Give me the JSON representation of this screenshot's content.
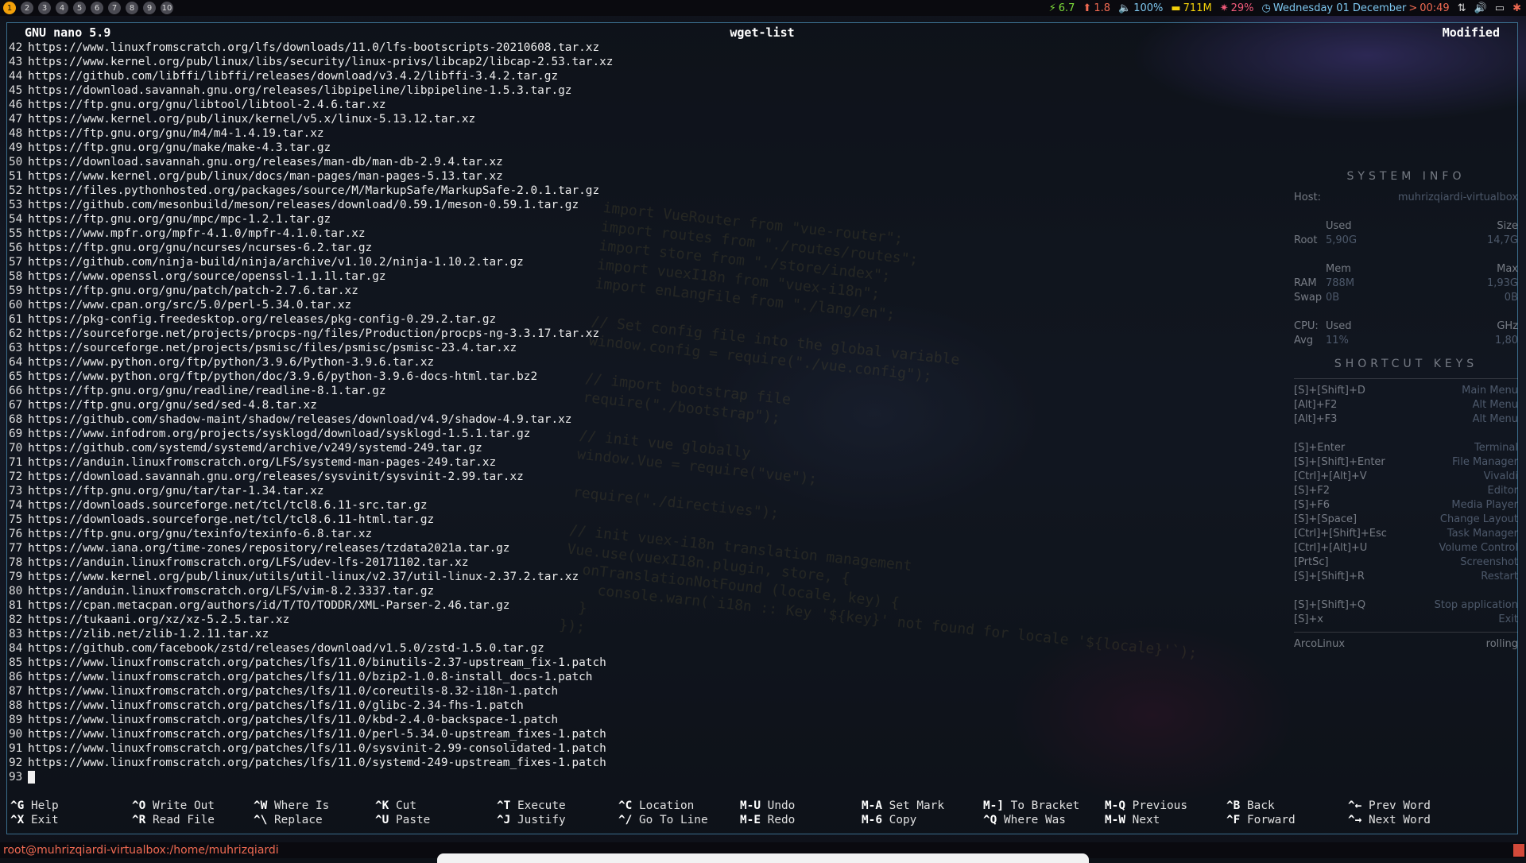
{
  "topbar": {
    "workspaces": [
      "1",
      "2",
      "3",
      "4",
      "5",
      "6",
      "7",
      "8",
      "9",
      "10"
    ],
    "active_workspace": "1",
    "status": {
      "cpu": "6.7",
      "upload": "1.8",
      "volume": "100%",
      "memory": "711M",
      "cpu_percent": "29%",
      "date": "Wednesday 01 December",
      "separator": ">",
      "time": "00:49"
    }
  },
  "nano": {
    "app_title": "GNU nano 5.9",
    "file_name": "wget-list",
    "state": "Modified",
    "lines": [
      {
        "n": "42",
        "text": "https://www.linuxfromscratch.org/lfs/downloads/11.0/lfs-bootscripts-20210608.tar.xz"
      },
      {
        "n": "43",
        "text": "https://www.kernel.org/pub/linux/libs/security/linux-privs/libcap2/libcap-2.53.tar.xz"
      },
      {
        "n": "44",
        "text": "https://github.com/libffi/libffi/releases/download/v3.4.2/libffi-3.4.2.tar.gz"
      },
      {
        "n": "45",
        "text": "https://download.savannah.gnu.org/releases/libpipeline/libpipeline-1.5.3.tar.gz"
      },
      {
        "n": "46",
        "text": "https://ftp.gnu.org/gnu/libtool/libtool-2.4.6.tar.xz"
      },
      {
        "n": "47",
        "text": "https://www.kernel.org/pub/linux/kernel/v5.x/linux-5.13.12.tar.xz"
      },
      {
        "n": "48",
        "text": "https://ftp.gnu.org/gnu/m4/m4-1.4.19.tar.xz"
      },
      {
        "n": "49",
        "text": "https://ftp.gnu.org/gnu/make/make-4.3.tar.gz"
      },
      {
        "n": "50",
        "text": "https://download.savannah.gnu.org/releases/man-db/man-db-2.9.4.tar.xz"
      },
      {
        "n": "51",
        "text": "https://www.kernel.org/pub/linux/docs/man-pages/man-pages-5.13.tar.xz"
      },
      {
        "n": "52",
        "text": "https://files.pythonhosted.org/packages/source/M/MarkupSafe/MarkupSafe-2.0.1.tar.gz"
      },
      {
        "n": "53",
        "text": "https://github.com/mesonbuild/meson/releases/download/0.59.1/meson-0.59.1.tar.gz"
      },
      {
        "n": "54",
        "text": "https://ftp.gnu.org/gnu/mpc/mpc-1.2.1.tar.gz"
      },
      {
        "n": "55",
        "text": "https://www.mpfr.org/mpfr-4.1.0/mpfr-4.1.0.tar.xz"
      },
      {
        "n": "56",
        "text": "https://ftp.gnu.org/gnu/ncurses/ncurses-6.2.tar.gz"
      },
      {
        "n": "57",
        "text": "https://github.com/ninja-build/ninja/archive/v1.10.2/ninja-1.10.2.tar.gz"
      },
      {
        "n": "58",
        "text": "https://www.openssl.org/source/openssl-1.1.1l.tar.gz"
      },
      {
        "n": "59",
        "text": "https://ftp.gnu.org/gnu/patch/patch-2.7.6.tar.xz"
      },
      {
        "n": "60",
        "text": "https://www.cpan.org/src/5.0/perl-5.34.0.tar.xz"
      },
      {
        "n": "61",
        "text": "https://pkg-config.freedesktop.org/releases/pkg-config-0.29.2.tar.gz"
      },
      {
        "n": "62",
        "text": "https://sourceforge.net/projects/procps-ng/files/Production/procps-ng-3.3.17.tar.xz"
      },
      {
        "n": "63",
        "text": "https://sourceforge.net/projects/psmisc/files/psmisc/psmisc-23.4.tar.xz"
      },
      {
        "n": "64",
        "text": "https://www.python.org/ftp/python/3.9.6/Python-3.9.6.tar.xz"
      },
      {
        "n": "65",
        "text": "https://www.python.org/ftp/python/doc/3.9.6/python-3.9.6-docs-html.tar.bz2"
      },
      {
        "n": "66",
        "text": "https://ftp.gnu.org/gnu/readline/readline-8.1.tar.gz"
      },
      {
        "n": "67",
        "text": "https://ftp.gnu.org/gnu/sed/sed-4.8.tar.xz"
      },
      {
        "n": "68",
        "text": "https://github.com/shadow-maint/shadow/releases/download/v4.9/shadow-4.9.tar.xz"
      },
      {
        "n": "69",
        "text": "https://www.infodrom.org/projects/sysklogd/download/sysklogd-1.5.1.tar.gz"
      },
      {
        "n": "70",
        "text": "https://github.com/systemd/systemd/archive/v249/systemd-249.tar.gz"
      },
      {
        "n": "71",
        "text": "https://anduin.linuxfromscratch.org/LFS/systemd-man-pages-249.tar.xz"
      },
      {
        "n": "72",
        "text": "https://download.savannah.gnu.org/releases/sysvinit/sysvinit-2.99.tar.xz"
      },
      {
        "n": "73",
        "text": "https://ftp.gnu.org/gnu/tar/tar-1.34.tar.xz"
      },
      {
        "n": "74",
        "text": "https://downloads.sourceforge.net/tcl/tcl8.6.11-src.tar.gz"
      },
      {
        "n": "75",
        "text": "https://downloads.sourceforge.net/tcl/tcl8.6.11-html.tar.gz"
      },
      {
        "n": "76",
        "text": "https://ftp.gnu.org/gnu/texinfo/texinfo-6.8.tar.xz"
      },
      {
        "n": "77",
        "text": "https://www.iana.org/time-zones/repository/releases/tzdata2021a.tar.gz"
      },
      {
        "n": "78",
        "text": "https://anduin.linuxfromscratch.org/LFS/udev-lfs-20171102.tar.xz"
      },
      {
        "n": "79",
        "text": "https://www.kernel.org/pub/linux/utils/util-linux/v2.37/util-linux-2.37.2.tar.xz"
      },
      {
        "n": "80",
        "text": "https://anduin.linuxfromscratch.org/LFS/vim-8.2.3337.tar.gz"
      },
      {
        "n": "81",
        "text": "https://cpan.metacpan.org/authors/id/T/TO/TODDR/XML-Parser-2.46.tar.gz"
      },
      {
        "n": "82",
        "text": "https://tukaani.org/xz/xz-5.2.5.tar.xz"
      },
      {
        "n": "83",
        "text": "https://zlib.net/zlib-1.2.11.tar.xz"
      },
      {
        "n": "84",
        "text": "https://github.com/facebook/zstd/releases/download/v1.5.0/zstd-1.5.0.tar.gz"
      },
      {
        "n": "85",
        "text": "https://www.linuxfromscratch.org/patches/lfs/11.0/binutils-2.37-upstream_fix-1.patch"
      },
      {
        "n": "86",
        "text": "https://www.linuxfromscratch.org/patches/lfs/11.0/bzip2-1.0.8-install_docs-1.patch"
      },
      {
        "n": "87",
        "text": "https://www.linuxfromscratch.org/patches/lfs/11.0/coreutils-8.32-i18n-1.patch"
      },
      {
        "n": "88",
        "text": "https://www.linuxfromscratch.org/patches/lfs/11.0/glibc-2.34-fhs-1.patch"
      },
      {
        "n": "89",
        "text": "https://www.linuxfromscratch.org/patches/lfs/11.0/kbd-2.4.0-backspace-1.patch"
      },
      {
        "n": "90",
        "text": "https://www.linuxfromscratch.org/patches/lfs/11.0/perl-5.34.0-upstream_fixes-1.patch"
      },
      {
        "n": "91",
        "text": "https://www.linuxfromscratch.org/patches/lfs/11.0/sysvinit-2.99-consolidated-1.patch"
      },
      {
        "n": "92",
        "text": "https://www.linuxfromscratch.org/patches/lfs/11.0/systemd-249-upstream_fixes-1.patch"
      },
      {
        "n": "93",
        "text": ""
      }
    ],
    "shortcuts_row1": [
      {
        "key": "^G",
        "label": "Help"
      },
      {
        "key": "^O",
        "label": "Write Out"
      },
      {
        "key": "^W",
        "label": "Where Is"
      },
      {
        "key": "^K",
        "label": "Cut"
      },
      {
        "key": "^T",
        "label": "Execute"
      },
      {
        "key": "^C",
        "label": "Location"
      },
      {
        "key": "M-U",
        "label": "Undo"
      },
      {
        "key": "M-A",
        "label": "Set Mark"
      },
      {
        "key": "M-]",
        "label": "To Bracket"
      },
      {
        "key": "M-Q",
        "label": "Previous"
      },
      {
        "key": "^B",
        "label": "Back"
      },
      {
        "key": "^←",
        "label": "Prev Word"
      }
    ],
    "shortcuts_row2": [
      {
        "key": "^X",
        "label": "Exit"
      },
      {
        "key": "^R",
        "label": "Read File"
      },
      {
        "key": "^\\",
        "label": "Replace"
      },
      {
        "key": "^U",
        "label": "Paste"
      },
      {
        "key": "^J",
        "label": "Justify"
      },
      {
        "key": "^/",
        "label": "Go To Line"
      },
      {
        "key": "M-E",
        "label": "Redo"
      },
      {
        "key": "M-6",
        "label": "Copy"
      },
      {
        "key": "^Q",
        "label": "Where Was"
      },
      {
        "key": "M-W",
        "label": "Next"
      },
      {
        "key": "^F",
        "label": "Forward"
      },
      {
        "key": "^→",
        "label": "Next Word"
      }
    ]
  },
  "conky": {
    "system_info_title": "SYSTEM INFO",
    "host_label": "Host:",
    "host_value": "muhrizqiardi-virtualbox",
    "disk_head": {
      "used": "Used",
      "size": "Size"
    },
    "root": {
      "label": "Root",
      "used": "5,90G",
      "size": "14,7G"
    },
    "mem_head": {
      "mem": "Mem",
      "max": "Max"
    },
    "ram": {
      "label": "RAM",
      "used": "788M",
      "max": "1,93G"
    },
    "swap": {
      "label": "Swap",
      "used": "0B",
      "max": "0B"
    },
    "cpu_head": {
      "label": "CPU:",
      "used": "Used",
      "unit": "GHz"
    },
    "avg": {
      "label": "Avg",
      "used": "11%",
      "ghz": "1,80"
    },
    "shortcut_title": "SHORTCUT KEYS",
    "shortcuts": [
      {
        "key": "[S]+[Shift]+D",
        "action": "Main Menu"
      },
      {
        "key": "[Alt]+F2",
        "action": "Alt Menu"
      },
      {
        "key": "[Alt]+F3",
        "action": "Alt Menu"
      },
      {
        "key": "",
        "action": ""
      },
      {
        "key": "[S]+Enter",
        "action": "Terminal"
      },
      {
        "key": "[S]+[Shift]+Enter",
        "action": "File Manager"
      },
      {
        "key": "[Ctrl]+[Alt]+V",
        "action": "Vivaldi"
      },
      {
        "key": "[S]+F2",
        "action": "Editor"
      },
      {
        "key": "[S]+F6",
        "action": "Media Player"
      },
      {
        "key": "[S]+[Space]",
        "action": "Change Layout"
      },
      {
        "key": "[Ctrl]+[Shift]+Esc",
        "action": "Task Manager"
      },
      {
        "key": "[Ctrl]+[Alt]+U",
        "action": "Volume Control"
      },
      {
        "key": "[PrtSc]",
        "action": "Screenshot"
      },
      {
        "key": "[S]+[Shift]+R",
        "action": "Restart"
      },
      {
        "key": "",
        "action": ""
      },
      {
        "key": "[S]+[Shift]+Q",
        "action": "Stop application"
      },
      {
        "key": "[S]+x",
        "action": "Exit"
      }
    ],
    "distro": "ArcoLinux",
    "release": "rolling"
  },
  "bottombar": {
    "prompt": "root@muhrizqiardi-virtualbox:/home/muhrizqiardi"
  },
  "colors": {
    "accent": "#f3a10a",
    "border": "#3a6d8c",
    "prompt": "#f06a52"
  }
}
